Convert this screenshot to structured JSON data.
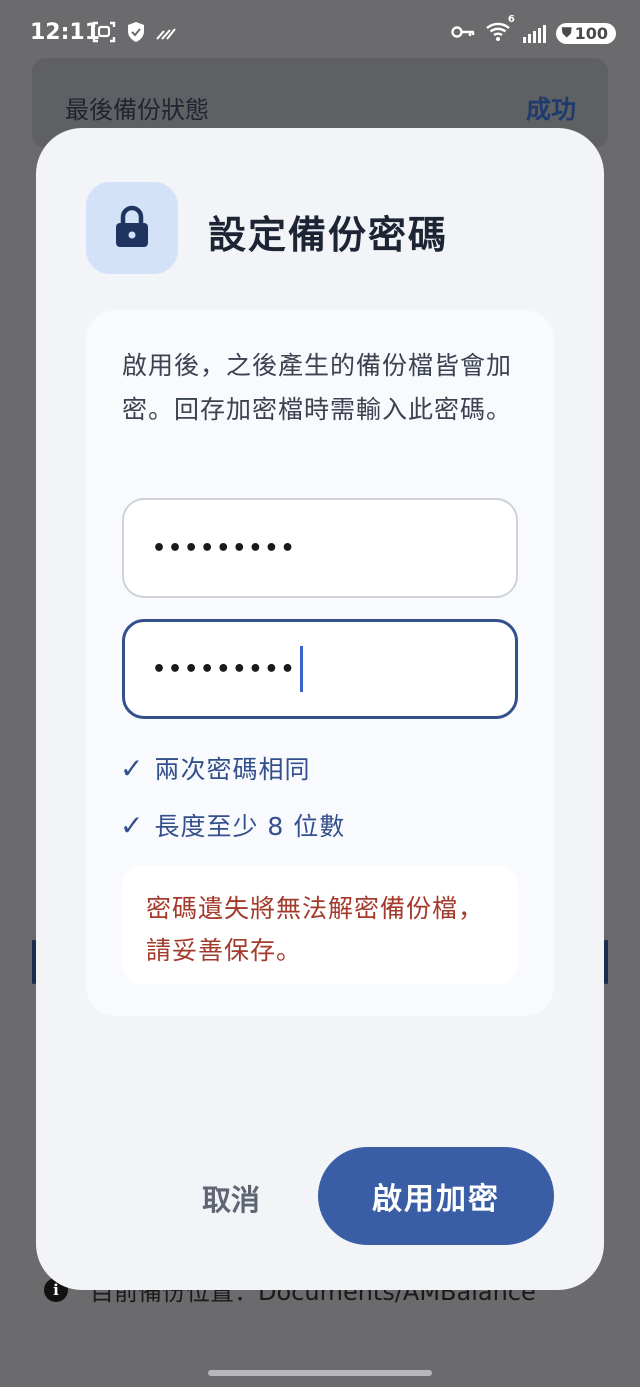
{
  "status_bar": {
    "time": "12:11",
    "battery": "100",
    "wifi_badge": "6"
  },
  "background": {
    "last_backup_label": "最後備份狀態",
    "last_backup_value": "成功",
    "info_text": "目前備份位置：Documents/AMBalance"
  },
  "dialog": {
    "title": "設定備份密碼",
    "description": "啟用後，之後產生的備份檔皆會加密。回存加密檔時需輸入此密碼。",
    "password_mask": "•••••••••",
    "confirm_mask": "•••••••••",
    "checks": [
      {
        "mark": "✓",
        "label": "兩次密碼相同"
      },
      {
        "mark": "✓",
        "label": "長度至少 8 位數"
      }
    ],
    "warning": "密碼遺失將無法解密備份檔，請妥善保存。",
    "cancel_label": "取消",
    "confirm_label": "啟用加密"
  },
  "colors": {
    "accent": "#3a5ea6",
    "check": "#33508d",
    "warning_text": "#a33a2c",
    "dialog_bg": "#f2f4f8",
    "scrim": "#6b6b6d"
  }
}
